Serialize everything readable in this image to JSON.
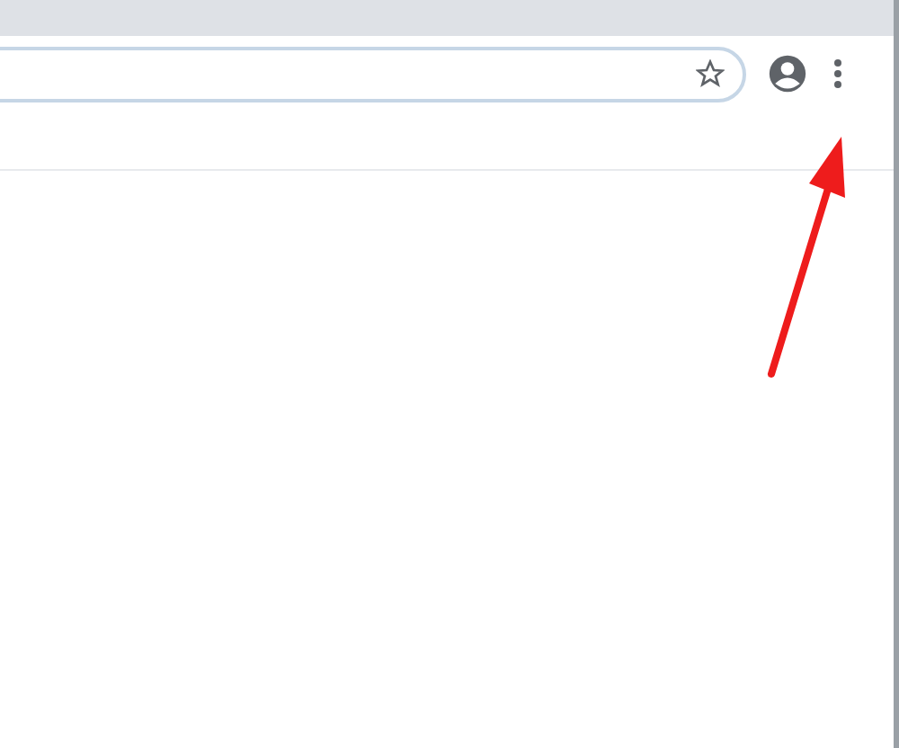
{
  "toolbar": {
    "address_bar": {
      "focused": true
    }
  },
  "annotation": {
    "kind": "arrow"
  }
}
